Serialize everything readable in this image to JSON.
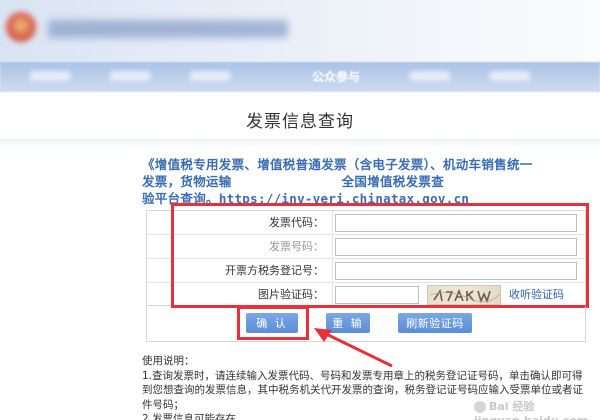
{
  "nav": {
    "active_item": "公众参与"
  },
  "page": {
    "title": "发票信息查询"
  },
  "notice": {
    "line1": "《增值税专用发票、增值税普通发票（含电子发票）、机动车销售统一",
    "line2_a": "发票，货物运输",
    "line2_b": "全国增值税发票查",
    "line3_a": "验平台查询。",
    "line3_url": "https://inv-veri.chinatax.gov.cn"
  },
  "form": {
    "rows": [
      {
        "label": "发票代码：",
        "value": ""
      },
      {
        "label": "发票号码：",
        "value": ""
      },
      {
        "label": "开票方税务登记号：",
        "value": ""
      },
      {
        "label": "图片验证码：",
        "value": ""
      }
    ],
    "refresh_link": "收听验证码"
  },
  "buttons": {
    "confirm": "确 认",
    "reset": "重 输",
    "refresh": "刷新验证码"
  },
  "instructions": {
    "heading": "使用说明：",
    "p1": "1.查询发票时，请连续输入发票代码、号码和发票专用章上的税务登记证号码，单击确认即可得到您想查询的发票信息，其中税务机关代开发票的查询，税务登记证号码应输入受票单位或者证件号码；",
    "p2": "2.发票信息可能存在"
  },
  "watermark": {
    "text": "Bai 经验 jingyan.baidu.com"
  },
  "colors": {
    "accent_red": "#e8303a",
    "button_blue": "#5b8dd6",
    "notice_blue": "#3a6db3"
  }
}
